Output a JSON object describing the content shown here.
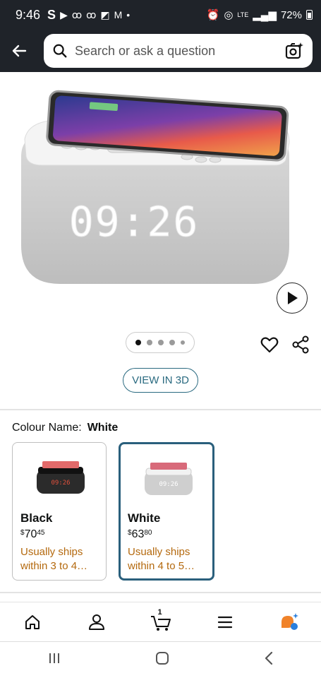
{
  "status_bar": {
    "time": "9:46",
    "battery": "72%",
    "network": "LTE"
  },
  "search": {
    "placeholder": "Search or ask a question"
  },
  "product": {
    "clock_display": "09:26"
  },
  "gallery": {
    "image_count": 5,
    "active_index": 0
  },
  "view3d": {
    "label": "VIEW IN 3D"
  },
  "colour": {
    "label": "Colour Name:",
    "selected": "White",
    "options": [
      {
        "name": "Black",
        "price_currency": "$",
        "price_whole": "70",
        "price_cents": "45",
        "shipping": "Usually ships within 3 to 4…",
        "selected": false
      },
      {
        "name": "White",
        "price_currency": "$",
        "price_whole": "63",
        "price_cents": "80",
        "shipping": "Usually ships within 4 to 5…",
        "selected": true
      }
    ]
  },
  "bottom_nav": {
    "cart_count": "1",
    "items": [
      "home-icon",
      "account-icon",
      "cart-icon",
      "menu-icon",
      "assistant-icon"
    ]
  },
  "colors": {
    "header_bg": "#1f2329",
    "accent_teal": "#2a6a80",
    "shipping_orange": "#b4690e",
    "selected_border": "#2a5f7c"
  }
}
